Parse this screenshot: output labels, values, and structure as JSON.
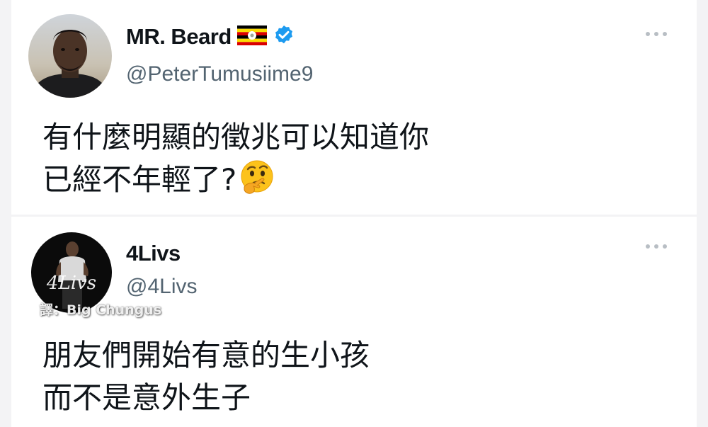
{
  "tweets": [
    {
      "display_name": "MR. Beard",
      "flag_icon": "uganda-flag-icon",
      "verified_icon": "verified-badge-icon",
      "handle": "@PeterTumusiime9",
      "more_icon": "more-horizontal-icon",
      "lines": [
        "有什麼明顯的徵兆可以知道你",
        "已經不年輕了?"
      ],
      "emoji": "thinking-face-emoji"
    },
    {
      "display_name": "4Livs",
      "avatar_signature": "4Livs",
      "handle": "@4Livs",
      "more_icon": "more-horizontal-icon",
      "lines": [
        "朋友們開始有意的生小孩",
        "而不是意外生子"
      ]
    }
  ],
  "watermark": "譯：Big Chungus",
  "colors": {
    "background": "#f3f3f5",
    "card": "#ffffff",
    "name_text": "#0f1419",
    "handle_text": "#536471",
    "verified_blue": "#1d9bf0",
    "more_dots": "#b8bec4"
  }
}
